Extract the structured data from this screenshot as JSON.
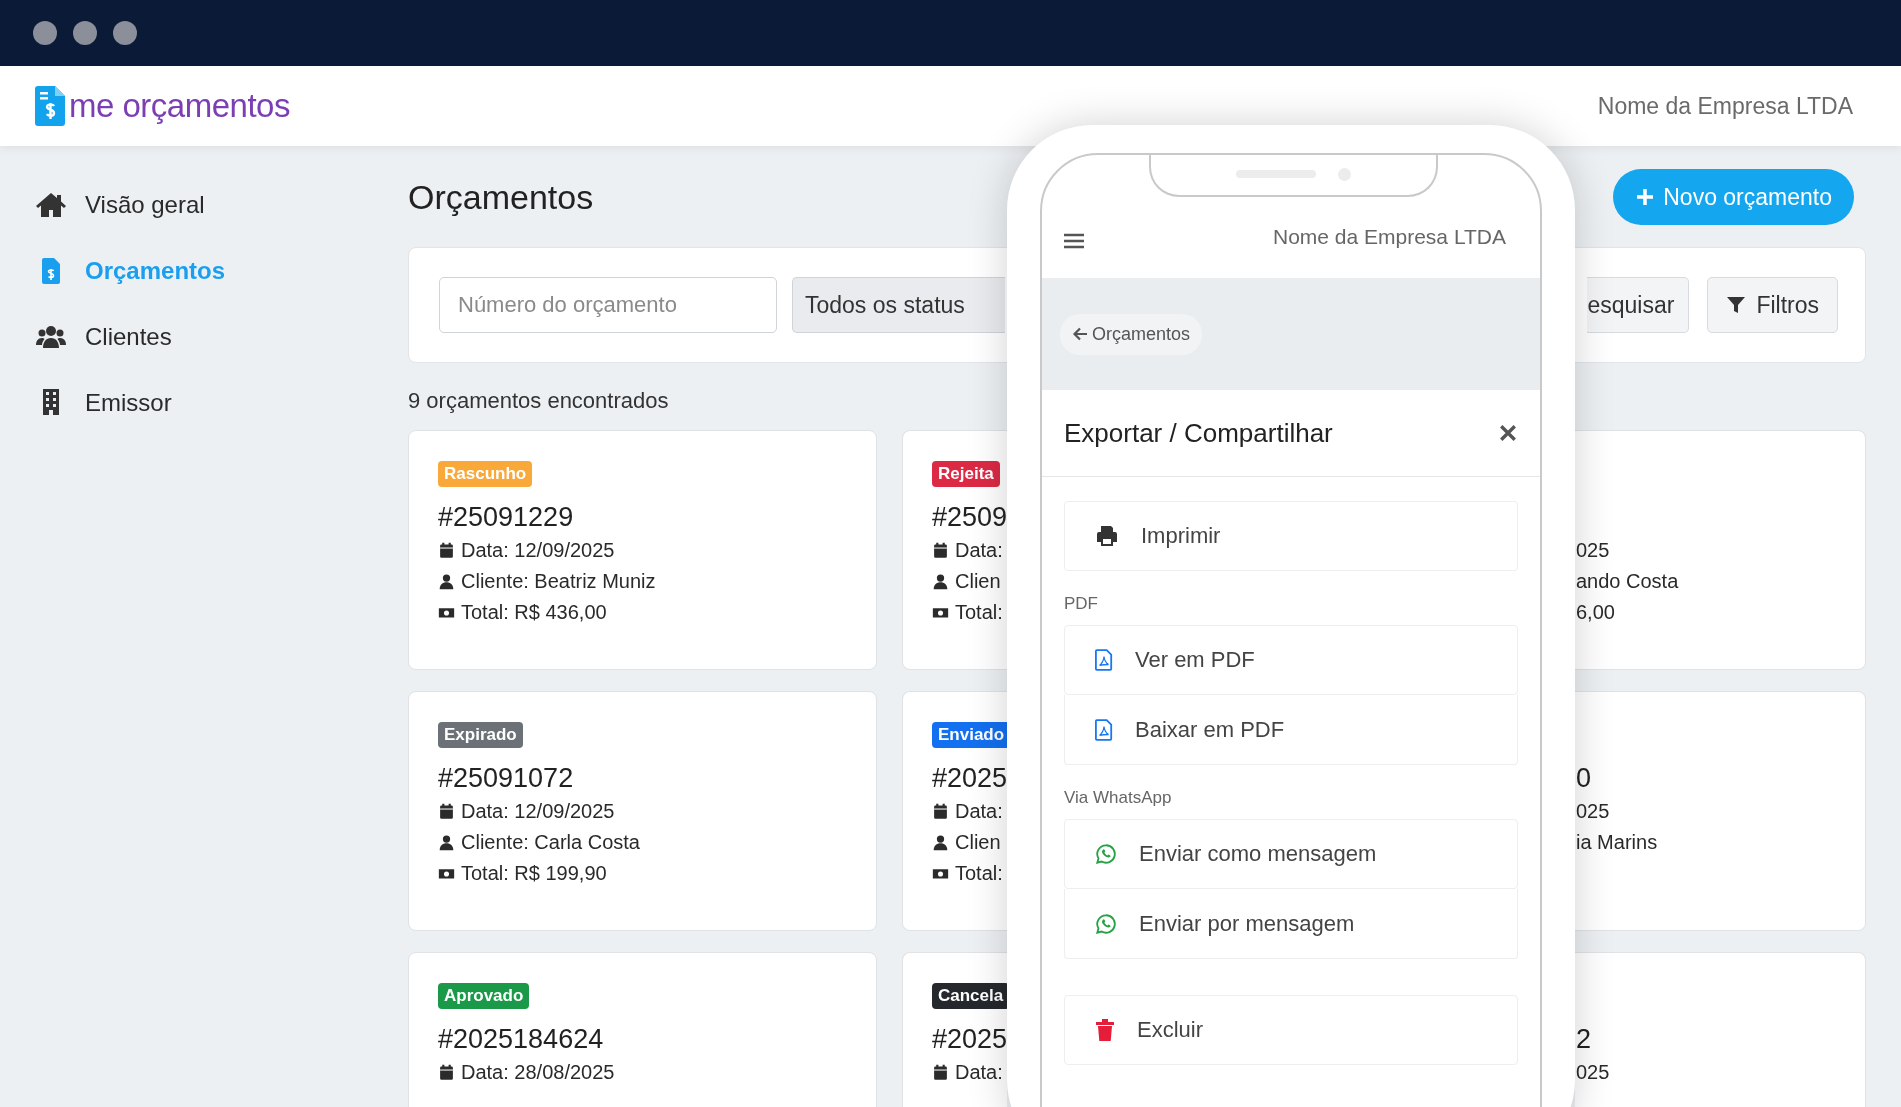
{
  "header": {
    "logo": "me orçamentos",
    "company": "Nome da Empresa LTDA"
  },
  "sidebar": {
    "items": [
      {
        "label": "Visão geral",
        "selected": false
      },
      {
        "label": "Orçamentos",
        "selected": true
      },
      {
        "label": "Clientes",
        "selected": false
      },
      {
        "label": "Emissor",
        "selected": false
      }
    ]
  },
  "page": {
    "title": "Orçamentos",
    "new_button": "Novo orçamento"
  },
  "filters": {
    "number_placeholder": "Número do orçamento",
    "status_value": "Todos os status",
    "search_button": "esquisar",
    "filter_button": "Filtros"
  },
  "result_count": "9 orçamentos encontrados",
  "cards": [
    {
      "badge": "Rascunho",
      "color": "#f9a83a",
      "number": "#25091229",
      "lines": [
        "Data: 12/09/2025",
        "Cliente: Beatriz Muniz",
        "Total: R$ 436,00"
      ]
    },
    {
      "badge": "Rejeita",
      "color": "#dc2a45",
      "number": "#2509",
      "lines": [
        "Data:",
        "Clien",
        "Total:"
      ]
    },
    {
      "lines": [
        "025",
        "ando Costa",
        "6,00"
      ]
    },
    {
      "badge": "Expirado",
      "color": "#6b7177",
      "number": "#25091072",
      "lines": [
        "Data: 12/09/2025",
        "Cliente: Carla Costa",
        "Total: R$ 199,90"
      ]
    },
    {
      "badge": "Enviado",
      "color": "#1370f0",
      "number": "#2025",
      "lines": [
        "Data:",
        "Clien",
        "Total:"
      ]
    },
    {
      "number": "0",
      "lines": [
        "025",
        "ia Marins"
      ]
    },
    {
      "badge": "Aprovado",
      "color": "#1a9a49",
      "number": "#2025184624",
      "lines": [
        "Data: 28/08/2025"
      ]
    },
    {
      "badge": "Cancela",
      "color": "#25282c",
      "number": "#2025",
      "lines": [
        "Data:"
      ]
    },
    {
      "number": "2",
      "lines": [
        "025"
      ]
    }
  ],
  "phone": {
    "company": "Nome da Empresa LTDA",
    "back_link": "Orçamentos",
    "modal": {
      "title": "Exportar / Compartilhar",
      "sections": [
        {
          "items": [
            {
              "label": "Imprimir",
              "kind": "print"
            }
          ]
        },
        {
          "heading": "PDF",
          "items": [
            {
              "label": "Ver em PDF",
              "kind": "pdf"
            },
            {
              "label": "Baixar em PDF",
              "kind": "pdf"
            }
          ]
        },
        {
          "heading": "Via WhatsApp",
          "items": [
            {
              "label": "Enviar como mensagem",
              "kind": "whatsapp"
            },
            {
              "label": "Enviar por mensagem",
              "kind": "whatsapp"
            }
          ]
        },
        {
          "items": [
            {
              "label": "Excluir",
              "kind": "delete"
            }
          ]
        }
      ]
    }
  }
}
